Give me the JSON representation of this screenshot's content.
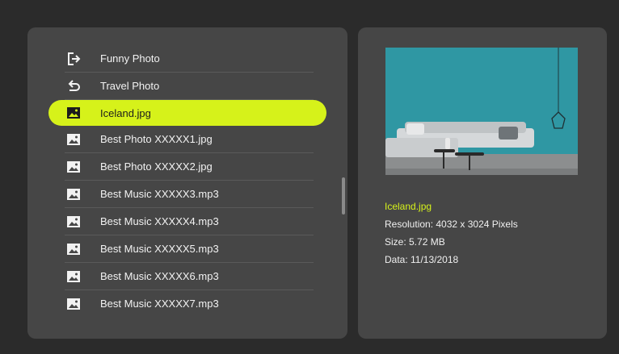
{
  "file_list": {
    "items": [
      {
        "label": "Funny Photo",
        "icon": "exit-icon",
        "selected": false
      },
      {
        "label": "Travel Photo",
        "icon": "back-icon",
        "selected": false
      },
      {
        "label": "Iceland.jpg",
        "icon": "image-icon",
        "selected": true
      },
      {
        "label": "Best Photo XXXXX1.jpg",
        "icon": "image-icon",
        "selected": false
      },
      {
        "label": "Best Photo XXXXX2.jpg",
        "icon": "image-icon",
        "selected": false
      },
      {
        "label": "Best Music XXXXX3.mp3",
        "icon": "image-icon",
        "selected": false
      },
      {
        "label": "Best Music XXXXX4.mp3",
        "icon": "image-icon",
        "selected": false
      },
      {
        "label": "Best Music XXXXX5.mp3",
        "icon": "image-icon",
        "selected": false
      },
      {
        "label": "Best Music XXXXX6.mp3",
        "icon": "image-icon",
        "selected": false
      },
      {
        "label": "Best Music XXXXX7.mp3",
        "icon": "image-icon",
        "selected": false
      }
    ]
  },
  "details": {
    "file_name": "Iceland.jpg",
    "resolution": "Resolution: 4032 x 3024 Pixels",
    "size": "Size: 5.72 MB",
    "date": "Data: 11/13/2018"
  },
  "colors": {
    "accent": "#d6f21a",
    "panel": "#464646",
    "background": "#2b2b2b"
  }
}
